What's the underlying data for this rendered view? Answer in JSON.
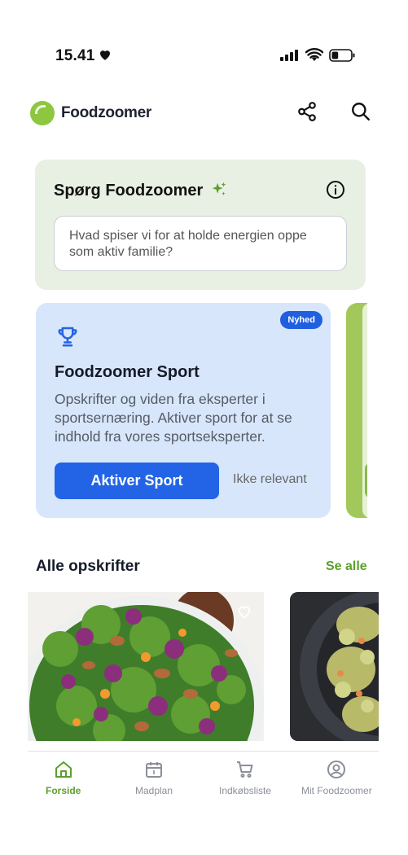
{
  "status_bar": {
    "time": "15.41",
    "heart_icon": "heart-icon",
    "signal_icon": "cellular-signal-icon",
    "wifi_icon": "wifi-icon",
    "battery_icon": "battery-icon",
    "battery_level": 0.35
  },
  "header": {
    "app_name": "Foodzoomer",
    "share_icon": "share-icon",
    "search_icon": "search-icon"
  },
  "ask_card": {
    "title": "Spørg Foodzoomer",
    "sparkle_icon": "sparkle-icon",
    "info_icon": "info-icon",
    "placeholder": "Hvad spiser vi for at holde energien oppe som aktiv familie?"
  },
  "sport_card": {
    "badge": "Nyhed",
    "trophy_icon": "trophy-icon",
    "title": "Foodzoomer Sport",
    "description": "Opskrifter og viden fra eksperter i sportsernæring. Aktiver sport for at se indhold fra vores sportseksperter.",
    "primary_button": "Aktiver Sport",
    "secondary_button": "Ikke relevant"
  },
  "recipes": {
    "title": "Alle opskrifter",
    "see_all": "Se alle",
    "favorite_icon": "heart-outline-icon"
  },
  "tabs": [
    {
      "label": "Forside",
      "icon": "home-icon",
      "active": true
    },
    {
      "label": "Madplan",
      "icon": "calendar-icon",
      "active": false
    },
    {
      "label": "Indkøbsliste",
      "icon": "cart-icon",
      "active": false
    },
    {
      "label": "Mit Foodzoomer",
      "icon": "profile-icon",
      "active": false
    }
  ],
  "colors": {
    "accent_green": "#5aa02c",
    "primary_blue": "#2264e5",
    "ask_card_bg": "#e8efe3",
    "sport_card_bg": "#d8e6fb"
  }
}
